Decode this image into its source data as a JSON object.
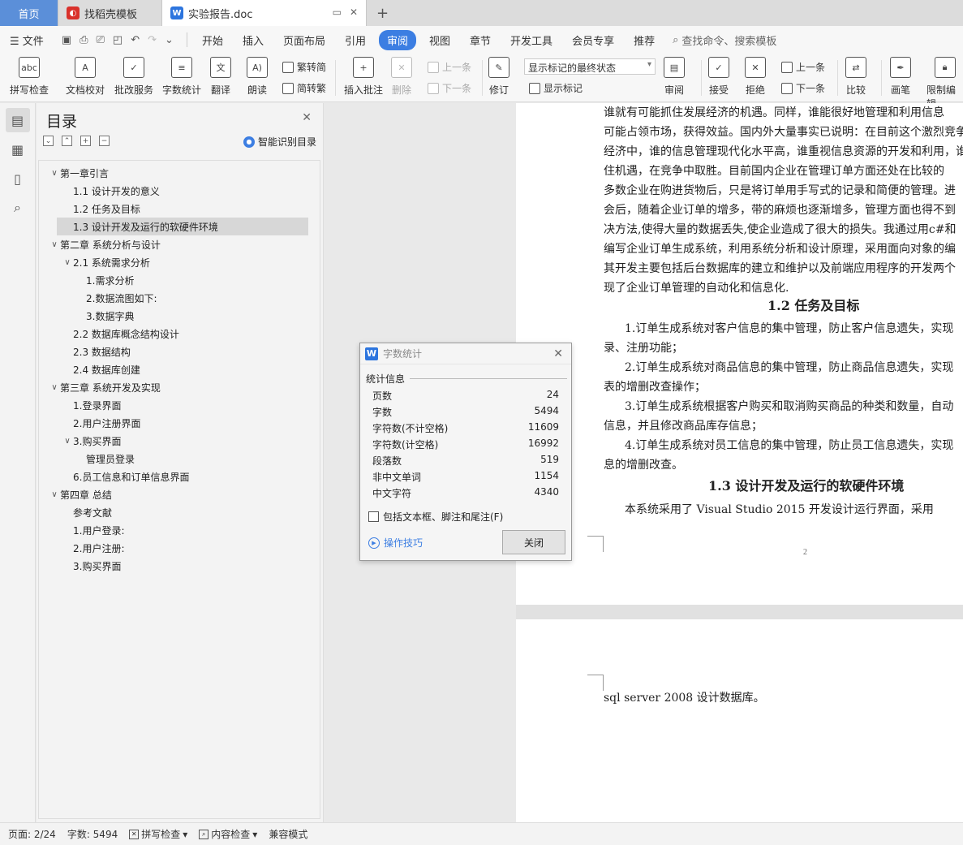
{
  "tabs": {
    "home": "首页",
    "templates": "找稻壳模板",
    "document": "实验报告.doc"
  },
  "menu": {
    "file": "文件",
    "items": [
      "开始",
      "插入",
      "页面布局",
      "引用",
      "审阅",
      "视图",
      "章节",
      "开发工具",
      "会员专享",
      "推荐"
    ],
    "active": "审阅",
    "search": "查找命令、搜索模板"
  },
  "ribbon": {
    "spell_check": "拼写检查",
    "doc_proof": "文档校对",
    "annotate_service": "批改服务",
    "word_count": "字数统计",
    "translate": "翻译",
    "read_aloud": "朗读",
    "trad_to_simp": "繁转简",
    "simp_to_trad": "简转繁",
    "insert_comment": "插入批注",
    "delete": "删除",
    "prev_comment": "上一条",
    "next_comment": "下一条",
    "revise": "修订",
    "markup_state": "显示标记的最终状态",
    "show_markup": "显示标记",
    "review": "审阅",
    "accept": "接受",
    "reject": "拒绝",
    "prev_change": "上一条",
    "next_change": "下一条",
    "compare": "比较",
    "ink": "画笔",
    "restrict_edit": "限制编辑"
  },
  "toc": {
    "title": "目录",
    "smart": "智能识别目录",
    "items": [
      {
        "label": "第一章引言",
        "level": 0,
        "expander": "v"
      },
      {
        "label": "1.1  设计开发的意义",
        "level": 1,
        "expander": ""
      },
      {
        "label": "1.2  任务及目标",
        "level": 1,
        "expander": ""
      },
      {
        "label": "1.3  设计开发及运行的软硬件环境",
        "level": 1,
        "expander": "",
        "selected": true
      },
      {
        "label": "第二章  系统分析与设计",
        "level": 0,
        "expander": "v"
      },
      {
        "label": "2.1  系统需求分析",
        "level": 1,
        "expander": "v"
      },
      {
        "label": "1.需求分析",
        "level": 2,
        "expander": ""
      },
      {
        "label": "2.数据流图如下:",
        "level": 2,
        "expander": ""
      },
      {
        "label": "3.数据字典",
        "level": 2,
        "expander": ""
      },
      {
        "label": "2.2  数据库概念结构设计",
        "level": 1,
        "expander": ""
      },
      {
        "label": "2.3  数据结构",
        "level": 1,
        "expander": ""
      },
      {
        "label": "2.4  数据库创建",
        "level": 1,
        "expander": ""
      },
      {
        "label": "第三章  系统开发及实现",
        "level": 0,
        "expander": "v"
      },
      {
        "label": "1.登录界面",
        "level": 1,
        "expander": ""
      },
      {
        "label": "2.用户注册界面",
        "level": 1,
        "expander": ""
      },
      {
        "label": "3.购买界面",
        "level": 1,
        "expander": "v"
      },
      {
        "label": "管理员登录",
        "level": 2,
        "expander": ""
      },
      {
        "label": "6.员工信息和订单信息界面",
        "level": 1,
        "expander": ""
      },
      {
        "label": "第四章  总结",
        "level": 0,
        "expander": "v"
      },
      {
        "label": "参考文献",
        "level": 1,
        "expander": ""
      },
      {
        "label": "1.用户登录:",
        "level": 1,
        "expander": ""
      },
      {
        "label": "2.用户注册:",
        "level": 1,
        "expander": ""
      },
      {
        "label": "3.购买界面",
        "level": 1,
        "expander": ""
      }
    ]
  },
  "document": {
    "page1_lines": [
      "谁就有可能抓住发展经济的机遇。同样，谁能很好地管理和利用信息",
      "可能占领市场，获得效益。国内外大量事实已说明：在目前这个激烈竞争",
      "经济中，谁的信息管理现代化水平高，谁重视信息资源的开发和利用，谁",
      "住机遇，在竞争中取胜。目前国内企业在管理订单方面还处在比较的",
      "多数企业在购进货物后，只是将订单用手写式的记录和简便的管理。进",
      "会后，随着企业订单的增多，带的麻烦也逐渐增多，管理方面也得不到",
      "决方法,使得大量的数据丢失,使企业造成了很大的损失。我通过用c#和",
      "编写企业订单生成系统，利用系统分析和设计原理，采用面向对象的编",
      "其开发主要包括后台数据库的建立和维护以及前端应用程序的开发两个",
      "现了企业订单管理的自动化和信息化."
    ],
    "heading_1_2": "1.2  任务及目标",
    "goals": [
      "1.订单生成系统对客户信息的集中管理，防止客户信息遗失，实现",
      "录、注册功能；",
      "2.订单生成系统对商品信息的集中管理，防止商品信息遗失，实现",
      "表的增删改查操作；",
      "3.订单生成系统根据客户购买和取消购买商品的种类和数量，自动",
      "信息，并且修改商品库存信息；",
      "4.订单生成系统对员工信息的集中管理，防止员工信息遗失，实现",
      "息的增删改查。"
    ],
    "heading_1_3": "1.3  设计开发及运行的软硬件环境",
    "env_line": "本系统采用了 Visual Studio 2015  开发设计运行界面，采用",
    "page_number": "2",
    "page2_line": "sql server 2008  设计数据库。"
  },
  "dialog": {
    "title": "字数统计",
    "section": "统计信息",
    "stats": [
      {
        "label": "页数",
        "value": "24"
      },
      {
        "label": "字数",
        "value": "5494"
      },
      {
        "label": "字符数(不计空格)",
        "value": "11609"
      },
      {
        "label": "字符数(计空格)",
        "value": "16992"
      },
      {
        "label": "段落数",
        "value": "519"
      },
      {
        "label": "非中文单词",
        "value": "1154"
      },
      {
        "label": "中文字符",
        "value": "4340"
      }
    ],
    "include_label": "包括文本框、脚注和尾注(F)",
    "tips": "操作技巧",
    "close": "关闭"
  },
  "statusbar": {
    "page": "页面: 2/24",
    "words": "字数: 5494",
    "spell": "拼写检查",
    "content_check": "内容检查",
    "compat": "兼容模式"
  }
}
